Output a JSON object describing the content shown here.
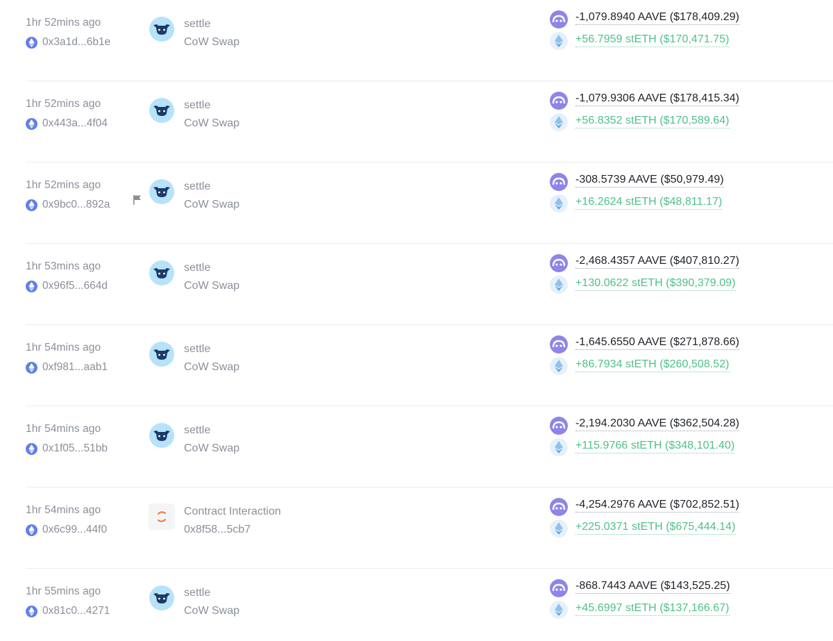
{
  "transactions": [
    {
      "time": "1hr 52mins ago",
      "hash": "0x3a1d...6b1e",
      "flagged": false,
      "app": "cow",
      "method": "settle",
      "target": "CoW Swap",
      "sent": "-1,079.8940 AAVE ($178,409.29)",
      "received": "+56.7959 stETH ($170,471.75)"
    },
    {
      "time": "1hr 52mins ago",
      "hash": "0x443a...4f04",
      "flagged": false,
      "app": "cow",
      "method": "settle",
      "target": "CoW Swap",
      "sent": "-1,079.9306 AAVE ($178,415.34)",
      "received": "+56.8352 stETH ($170,589.64)"
    },
    {
      "time": "1hr 52mins ago",
      "hash": "0x9bc0...892a",
      "flagged": true,
      "app": "cow",
      "method": "settle",
      "target": "CoW Swap",
      "sent": "-308.5739 AAVE ($50,979.49)",
      "received": "+16.2624 stETH ($48,811.17)"
    },
    {
      "time": "1hr 53mins ago",
      "hash": "0x96f5...664d",
      "flagged": false,
      "app": "cow",
      "method": "settle",
      "target": "CoW Swap",
      "sent": "-2,468.4357 AAVE ($407,810.27)",
      "received": "+130.0622 stETH ($390,379.09)"
    },
    {
      "time": "1hr 54mins ago",
      "hash": "0xf981...aab1",
      "flagged": false,
      "app": "cow",
      "method": "settle",
      "target": "CoW Swap",
      "sent": "-1,645.6550 AAVE ($271,878.66)",
      "received": "+86.7934 stETH ($260,508.52)"
    },
    {
      "time": "1hr 54mins ago",
      "hash": "0x1f05...51bb",
      "flagged": false,
      "app": "cow",
      "method": "settle",
      "target": "CoW Swap",
      "sent": "-2,194.2030 AAVE ($362,504.28)",
      "received": "+115.9766 stETH ($348,101.40)"
    },
    {
      "time": "1hr 54mins ago",
      "hash": "0x6c99...44f0",
      "flagged": false,
      "app": "contract",
      "method": "Contract Interaction",
      "target": "0x8f58...5cb7",
      "sent": "-4,254.2976 AAVE ($702,852.51)",
      "received": "+225.0371 stETH ($675,444.14)"
    },
    {
      "time": "1hr 55mins ago",
      "hash": "0x81c0...4271",
      "flagged": false,
      "app": "cow",
      "method": "settle",
      "target": "CoW Swap",
      "sent": "-868.7443 AAVE ($143,525.25)",
      "received": "+45.6997 stETH ($137,166.67)"
    }
  ],
  "colors": {
    "muted_text": "#8a8f99",
    "out_amount": "#1d2127",
    "in_amount": "#4fc08a",
    "aave": "#8f84e8",
    "eth": "#627eea",
    "cow_bg": "#b6e2fa",
    "cow_face": "#1b3a66",
    "divider": "#ebedf0"
  }
}
